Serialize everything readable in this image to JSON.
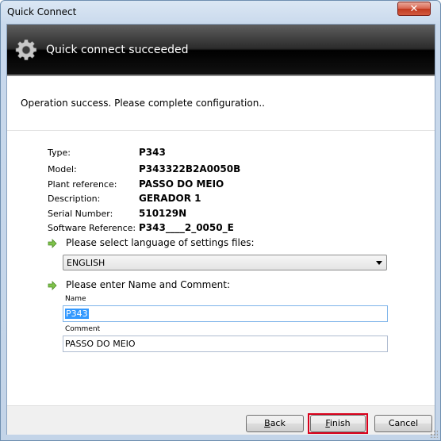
{
  "window": {
    "title": "Quick Connect",
    "close_label": "✕"
  },
  "banner": {
    "title": "Quick connect succeeded",
    "icon": "gear-icon"
  },
  "message": "Operation success. Please complete configuration..",
  "details": [
    {
      "label": "Type:",
      "value": "P343"
    },
    {
      "label": "Model:",
      "value": "P343322B2A0050B"
    },
    {
      "label": "Plant reference:",
      "value": "PASSO DO MEIO"
    },
    {
      "label": "Description:",
      "value": "GERADOR 1"
    },
    {
      "label": "Serial Number:",
      "value": "510129N"
    },
    {
      "label": "Software Reference:",
      "value": "P343____2_0050_E"
    }
  ],
  "language": {
    "prompt": "Please select language of settings files:",
    "selected": "ENGLISH"
  },
  "name_comment": {
    "prompt": "Please enter Name and Comment:",
    "name_label": "Name",
    "name_value": "P343",
    "comment_label": "Comment",
    "comment_value": "PASSO DO MEIO"
  },
  "buttons": {
    "back_mnemonic": "B",
    "back_rest": "ack",
    "finish_mnemonic": "F",
    "finish_rest": "inish",
    "cancel": "Cancel"
  },
  "colors": {
    "highlight_border": "#d9001b",
    "banner_bg": "#000000",
    "selection": "#3399ff"
  }
}
